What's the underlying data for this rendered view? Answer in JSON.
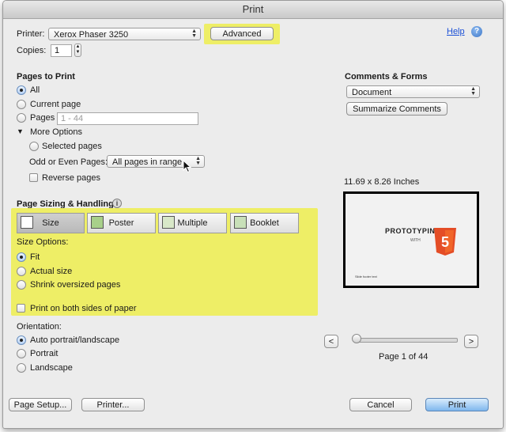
{
  "window": {
    "title": "Print"
  },
  "printer": {
    "label": "Printer:",
    "value": "Xerox Phaser 3250",
    "advanced_label": "Advanced",
    "help_label": "Help"
  },
  "copies": {
    "label": "Copies:",
    "value": "1"
  },
  "pages_to_print": {
    "heading": "Pages to Print",
    "all_label": "All",
    "current_label": "Current page",
    "pages_label": "Pages",
    "pages_placeholder": "1 - 44",
    "more_options_label": "More Options",
    "selected_pages_label": "Selected pages",
    "odd_even_label": "Odd or Even Pages:",
    "odd_even_value": "All pages in range",
    "reverse_label": "Reverse pages"
  },
  "sizing": {
    "heading": "Page Sizing & Handling",
    "info_symbol": "i",
    "tabs": [
      "Size",
      "Poster",
      "Multiple",
      "Booklet"
    ],
    "size_options_label": "Size Options:",
    "fit_label": "Fit",
    "actual_label": "Actual size",
    "shrink_label": "Shrink oversized pages",
    "both_sides_label": "Print on both sides of paper"
  },
  "orientation": {
    "heading": "Orientation:",
    "auto_label": "Auto portrait/landscape",
    "portrait_label": "Portrait",
    "landscape_label": "Landscape"
  },
  "comments": {
    "heading": "Comments & Forms",
    "value": "Document",
    "summarize_label": "Summarize Comments"
  },
  "preview": {
    "size_label": "11.69 x 8.26 Inches",
    "slide_title": "PROTOTYPING",
    "slide_with": "WITH",
    "badge_number": "5",
    "footer_text": "Slide footer text",
    "prev_label": "<",
    "next_label": ">",
    "page_indicator": "Page 1 of 44",
    "page_position": 0.0
  },
  "footer": {
    "page_setup_label": "Page Setup...",
    "printer_label": "Printer...",
    "cancel_label": "Cancel",
    "print_label": "Print"
  },
  "colors": {
    "highlight": "#eeee66",
    "html5_orange": "#e44d26",
    "help_blue": "#3f78c8"
  }
}
